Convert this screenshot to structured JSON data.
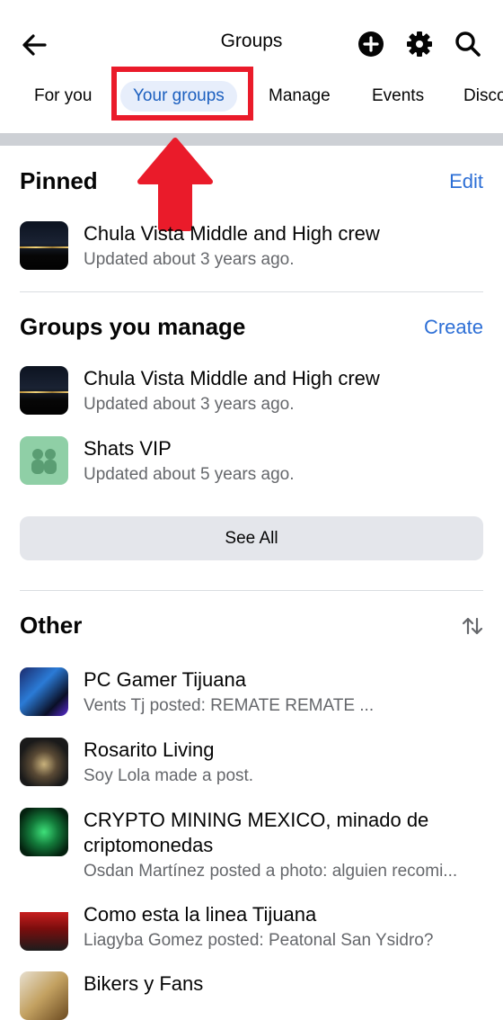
{
  "header": {
    "title": "Groups",
    "back_icon": "arrow-left-icon",
    "icons": [
      "plus-circle-icon",
      "gear-icon",
      "search-icon"
    ]
  },
  "tabs": [
    {
      "label": "For you"
    },
    {
      "label": "Your groups",
      "active": true
    },
    {
      "label": "Manage"
    },
    {
      "label": "Events"
    },
    {
      "label": "Disco"
    }
  ],
  "colors": {
    "accent": "#2d6fd6",
    "annotation": "#ea1b2a",
    "secondary_text": "#65676b"
  },
  "pinned": {
    "title": "Pinned",
    "action": "Edit",
    "items": [
      {
        "name": "Chula Vista Middle and High crew",
        "sub": "Updated about 3 years ago."
      }
    ]
  },
  "manage": {
    "title": "Groups you manage",
    "action": "Create",
    "items": [
      {
        "name": "Chula Vista Middle and High crew",
        "sub": "Updated about 3 years ago."
      },
      {
        "name": "Shats VIP",
        "sub": "Updated about 5 years ago."
      }
    ],
    "see_all": "See All"
  },
  "other": {
    "title": "Other",
    "sort_icon": "sort-arrows-icon",
    "items": [
      {
        "name": "PC Gamer Tijuana",
        "sub": "Vents Tj posted: REMATE REMATE ..."
      },
      {
        "name": "Rosarito Living",
        "sub": "Soy Lola made a post."
      },
      {
        "name": "CRYPTO MINING MEXICO, minado de criptomonedas",
        "sub": "Osdan Martínez posted a photo: alguien recomi..."
      },
      {
        "name": "Como esta la linea Tijuana",
        "sub": "Liagyba Gomez posted: Peatonal San Ysidro?"
      },
      {
        "name": "Bikers y Fans",
        "sub": ""
      }
    ]
  }
}
